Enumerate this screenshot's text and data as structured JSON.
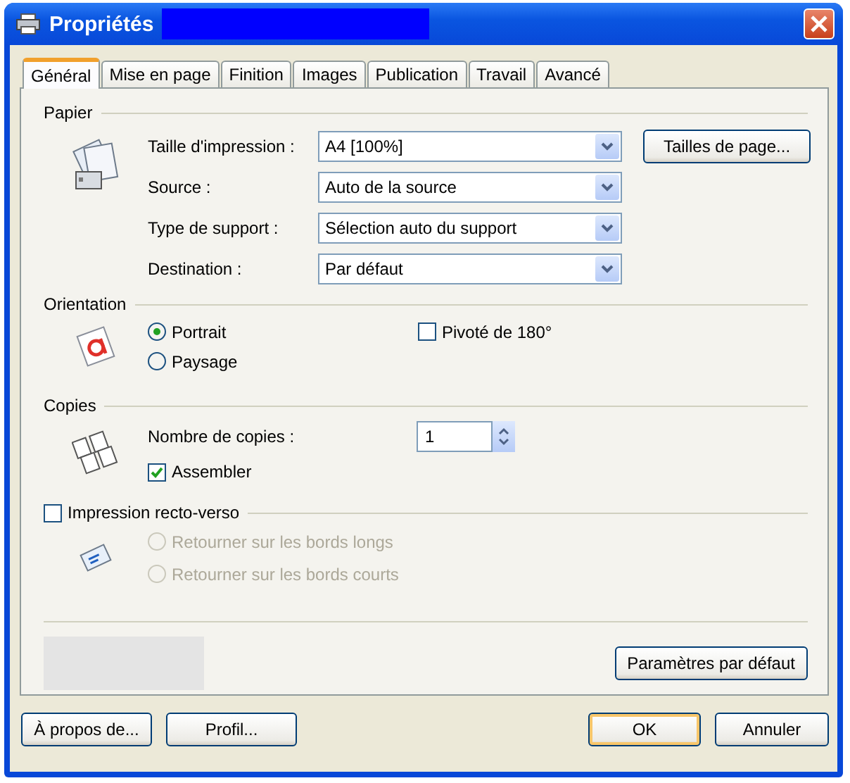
{
  "window": {
    "title": "Propriétés"
  },
  "tabs": [
    {
      "label": "Général",
      "selected": true
    },
    {
      "label": "Mise en page",
      "selected": false
    },
    {
      "label": "Finition",
      "selected": false
    },
    {
      "label": "Images",
      "selected": false
    },
    {
      "label": "Publication",
      "selected": false
    },
    {
      "label": "Travail",
      "selected": false
    },
    {
      "label": "Avancé",
      "selected": false
    }
  ],
  "paper": {
    "heading": "Papier",
    "fields": [
      {
        "label": "Taille d'impression :",
        "value": "A4  [100%]"
      },
      {
        "label": "Source :",
        "value": "Auto de la source"
      },
      {
        "label": "Type de support :",
        "value": "Sélection auto du support"
      },
      {
        "label": "Destination :",
        "value": "Par défaut"
      }
    ],
    "page_sizes_button": "Tailles de page..."
  },
  "orientation": {
    "heading": "Orientation",
    "options": [
      {
        "label": "Portrait",
        "selected": true
      },
      {
        "label": "Paysage",
        "selected": false
      }
    ],
    "rotate": {
      "label": "Pivoté de 180°",
      "checked": false
    }
  },
  "copies": {
    "heading": "Copies",
    "count_label": "Nombre de copies :",
    "count": "1",
    "collate": {
      "label": "Assembler",
      "checked": true
    }
  },
  "duplex": {
    "label": "Impression recto-verso",
    "checked": false,
    "options": [
      {
        "label": "Retourner sur les bords longs",
        "selected": false,
        "disabled": true
      },
      {
        "label": "Retourner sur les bords courts",
        "selected": false,
        "disabled": true
      }
    ]
  },
  "defaults_button": "Paramètres par défaut",
  "buttons": [
    {
      "label": "À propos de...",
      "default": false
    },
    {
      "label": "Profil...",
      "default": false
    },
    {
      "label": "OK",
      "default": true
    },
    {
      "label": "Annuler",
      "default": false
    }
  ]
}
